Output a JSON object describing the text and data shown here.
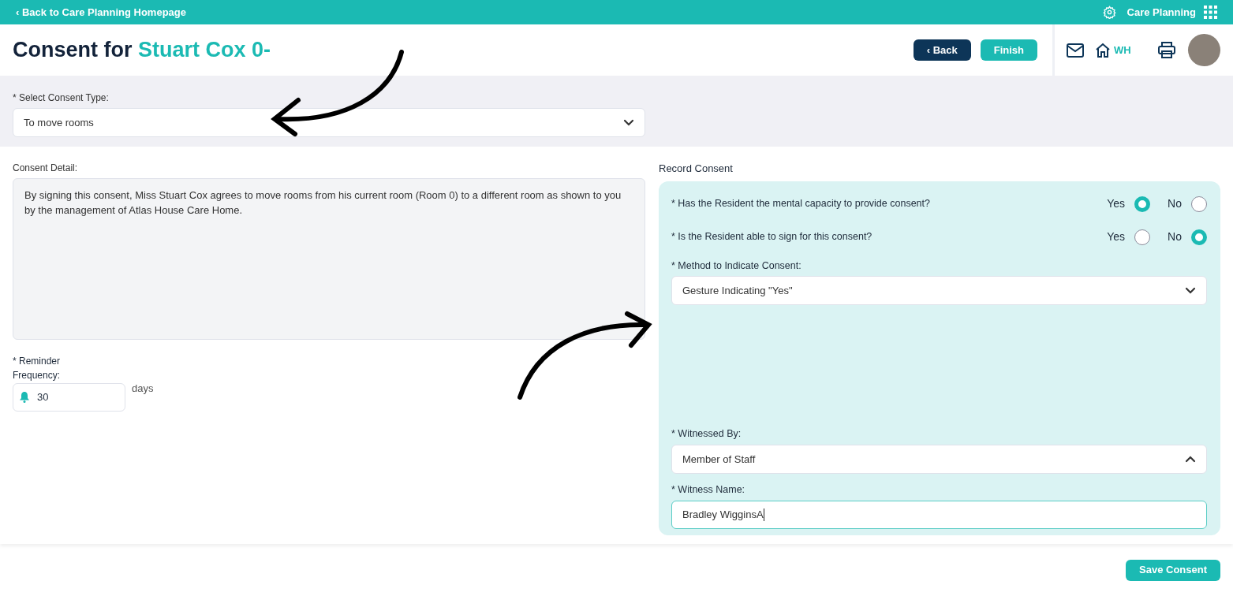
{
  "top_bar": {
    "back_link": "‹ Back to Care Planning Homepage",
    "app_name": "Care Planning"
  },
  "header": {
    "title_prefix": "Consent for",
    "resident_name": "Stuart Cox 0-",
    "buttons": [
      {
        "kind": "back",
        "label": "‹ Back"
      },
      {
        "kind": "finish",
        "label": "Finish"
      }
    ],
    "home_label": "WH"
  },
  "consent_type": {
    "label": "* Select Consent Type:",
    "value": "To move rooms"
  },
  "consent_detail": {
    "label": "Consent Detail:",
    "text": "By signing this consent, Miss Stuart Cox agrees to move rooms from his current room (Room 0) to a different room as shown to you by the management of Atlas House Care Home."
  },
  "reminder": {
    "label": "* Reminder Frequency:",
    "value": "30",
    "unit": "days"
  },
  "record_consent": {
    "title": "Record Consent",
    "questions": [
      {
        "text": "* Has the Resident the mental capacity to provide consent?",
        "options": [
          {
            "label": "Yes",
            "selected": true
          },
          {
            "label": "No",
            "selected": false
          }
        ]
      },
      {
        "text": "* Is the Resident able to sign for this consent?",
        "options": [
          {
            "label": "Yes",
            "selected": false
          },
          {
            "label": "No",
            "selected": true
          }
        ]
      }
    ],
    "method": {
      "label": "* Method to Indicate Consent:",
      "value": "Gesture Indicating \"Yes\"",
      "expanded": false
    },
    "witnessed_by": {
      "label": "* Witnessed By:",
      "value": "Member of Staff",
      "expanded": true
    },
    "witness_name": {
      "label": "* Witness Name:",
      "value": "Bradley WigginsA"
    }
  },
  "footer": {
    "save_button": "Save Consent"
  }
}
